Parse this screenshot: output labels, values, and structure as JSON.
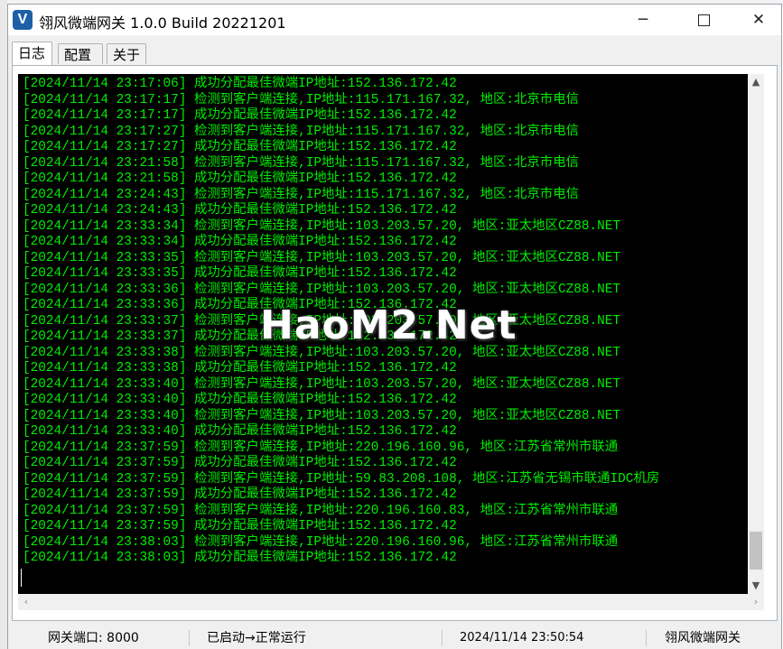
{
  "window": {
    "title": "翎风微端网关 1.0.0 Build 20221201",
    "minimize_glyph": "─",
    "close_glyph": "✕"
  },
  "tabs": [
    {
      "label": "日志",
      "active": true
    },
    {
      "label": "配置",
      "active": false
    },
    {
      "label": "关于",
      "active": false
    }
  ],
  "log": [
    "[2024/11/14 23:17:06] 成功分配最佳微端IP地址:152.136.172.42",
    "[2024/11/14 23:17:17] 检测到客户端连接,IP地址:115.171.167.32, 地区:北京市电信",
    "[2024/11/14 23:17:17] 成功分配最佳微端IP地址:152.136.172.42",
    "[2024/11/14 23:17:27] 检测到客户端连接,IP地址:115.171.167.32, 地区:北京市电信",
    "[2024/11/14 23:17:27] 成功分配最佳微端IP地址:152.136.172.42",
    "[2024/11/14 23:21:58] 检测到客户端连接,IP地址:115.171.167.32, 地区:北京市电信",
    "[2024/11/14 23:21:58] 成功分配最佳微端IP地址:152.136.172.42",
    "[2024/11/14 23:24:43] 检测到客户端连接,IP地址:115.171.167.32, 地区:北京市电信",
    "[2024/11/14 23:24:43] 成功分配最佳微端IP地址:152.136.172.42",
    "[2024/11/14 23:33:34] 检测到客户端连接,IP地址:103.203.57.20, 地区:亚太地区CZ88.NET",
    "[2024/11/14 23:33:34] 成功分配最佳微端IP地址:152.136.172.42",
    "[2024/11/14 23:33:35] 检测到客户端连接,IP地址:103.203.57.20, 地区:亚太地区CZ88.NET",
    "[2024/11/14 23:33:35] 成功分配最佳微端IP地址:152.136.172.42",
    "[2024/11/14 23:33:36] 检测到客户端连接,IP地址:103.203.57.20, 地区:亚太地区CZ88.NET",
    "[2024/11/14 23:33:36] 成功分配最佳微端IP地址:152.136.172.42",
    "[2024/11/14 23:33:37] 检测到客户端连接,IP地址:103.203.57.20, 地区:亚太地区CZ88.NET",
    "[2024/11/14 23:33:37] 成功分配最佳微端IP地址:152.136.172.42",
    "[2024/11/14 23:33:38] 检测到客户端连接,IP地址:103.203.57.20, 地区:亚太地区CZ88.NET",
    "[2024/11/14 23:33:38] 成功分配最佳微端IP地址:152.136.172.42",
    "[2024/11/14 23:33:40] 检测到客户端连接,IP地址:103.203.57.20, 地区:亚太地区CZ88.NET",
    "[2024/11/14 23:33:40] 成功分配最佳微端IP地址:152.136.172.42",
    "[2024/11/14 23:33:40] 检测到客户端连接,IP地址:103.203.57.20, 地区:亚太地区CZ88.NET",
    "[2024/11/14 23:33:40] 成功分配最佳微端IP地址:152.136.172.42",
    "[2024/11/14 23:37:59] 检测到客户端连接,IP地址:220.196.160.96, 地区:江苏省常州市联通",
    "[2024/11/14 23:37:59] 成功分配最佳微端IP地址:152.136.172.42",
    "[2024/11/14 23:37:59] 检测到客户端连接,IP地址:59.83.208.108, 地区:江苏省无锡市联通IDC机房",
    "[2024/11/14 23:37:59] 成功分配最佳微端IP地址:152.136.172.42",
    "[2024/11/14 23:37:59] 检测到客户端连接,IP地址:220.196.160.83, 地区:江苏省常州市联通",
    "[2024/11/14 23:37:59] 成功分配最佳微端IP地址:152.136.172.42",
    "[2024/11/14 23:38:03] 检测到客户端连接,IP地址:220.196.160.96, 地区:江苏省常州市联通",
    "[2024/11/14 23:38:03] 成功分配最佳微端IP地址:152.136.172.42"
  ],
  "watermark": "HaoM2.Net",
  "status": {
    "port": "网关端口: 8000",
    "state": "已启动→正常运行",
    "time": "2024/11/14 23:50:54",
    "app_name": "翎风微端网关"
  },
  "colors": {
    "log_text": "#00ee00",
    "console_bg": "#000000",
    "app_icon": "#1f5fa8"
  },
  "icons": {
    "app": "app-logo-v-icon",
    "vscroll_up": "chevron-up-icon",
    "vscroll_down": "chevron-down-icon",
    "hscroll_left": "chevron-left-icon",
    "hscroll_right": "chevron-right-icon"
  }
}
